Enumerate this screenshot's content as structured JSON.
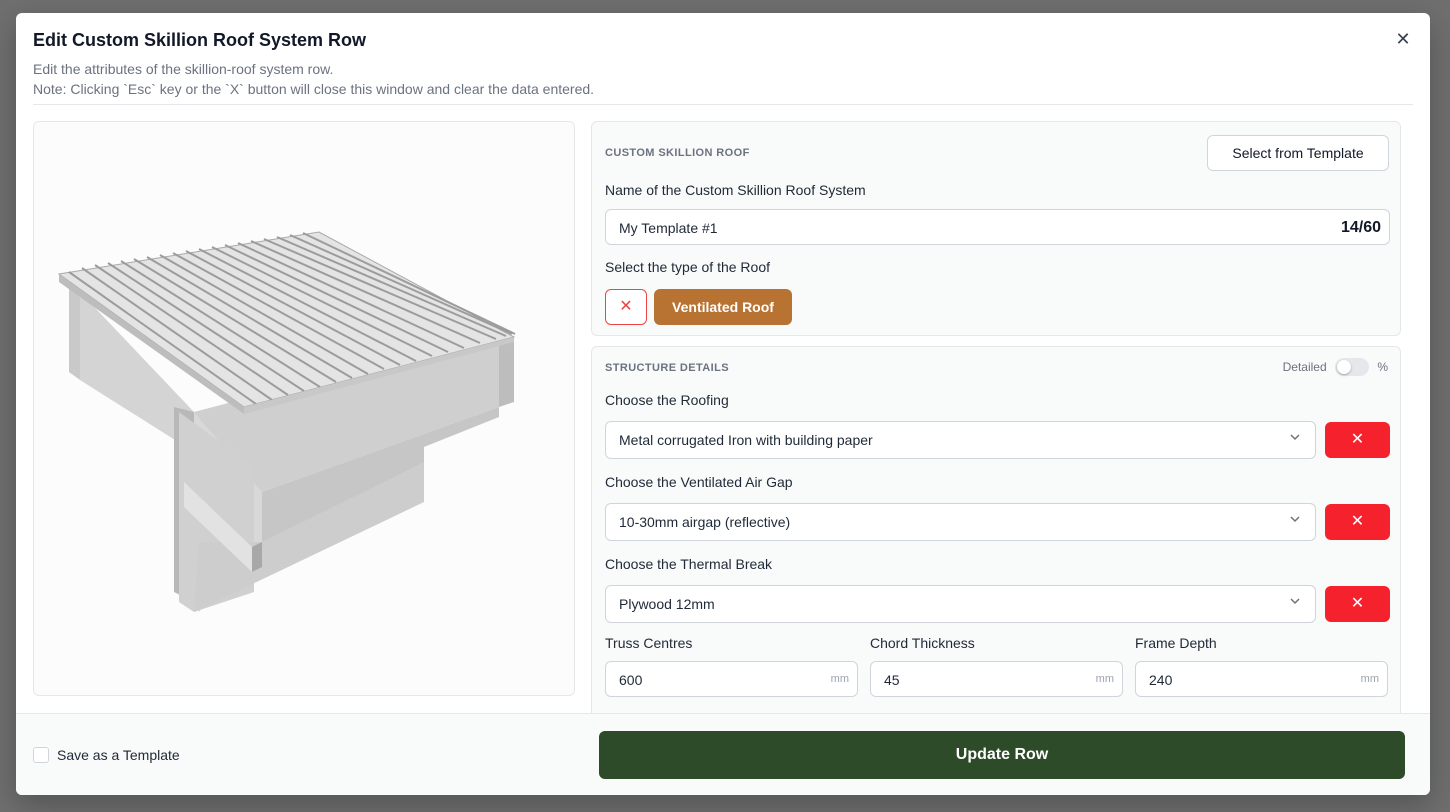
{
  "modal": {
    "title": "Edit Custom Skillion Roof System Row",
    "subtitle_line1": "Edit the attributes of the skillion-roof system row.",
    "subtitle_line2": "Note: Clicking `Esc` key or the `X` button will close this window and clear the data entered.",
    "close_glyph": "✕"
  },
  "custom_roof": {
    "section_label": "CUSTOM SKILLION ROOF",
    "template_button": "Select from Template",
    "name_label": "Name of the Custom Skillion Roof System",
    "name_value": "My Template #1",
    "name_counter": "14/60",
    "type_label": "Select the type of the Roof",
    "clear_glyph": "✕",
    "type_value": "Ventilated Roof",
    "type_color": "#b87333"
  },
  "structure": {
    "section_label": "STRUCTURE DETAILS",
    "toggle_left": "Detailed",
    "toggle_right": "%",
    "toggle_on": false,
    "roofing_label": "Choose the Roofing",
    "roofing_value": "Metal corrugated Iron with building paper",
    "airgap_label": "Choose the Ventilated Air Gap",
    "airgap_value": "10-30mm airgap (reflective)",
    "thermal_label": "Choose the Thermal Break",
    "thermal_value": "Plywood 12mm",
    "remove_glyph": "✕",
    "remove_color": "#f5222d",
    "truss_label": "Truss Centres",
    "truss_value": "600",
    "chord_label": "Chord Thickness",
    "chord_value": "45",
    "frame_label": "Frame Depth",
    "frame_value": "240",
    "unit": "mm"
  },
  "footer": {
    "save_template_label": "Save as a Template",
    "save_template_checked": false,
    "update_button": "Update Row",
    "update_color": "#2d4a29"
  }
}
